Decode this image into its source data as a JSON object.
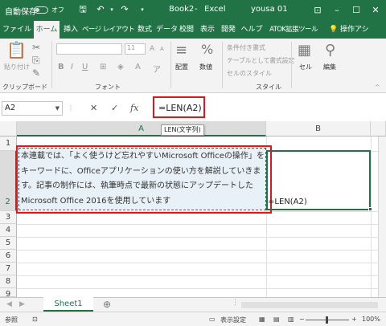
{
  "title_bar": {
    "autosave_label": "自動保存",
    "toggle_state": "オフ",
    "document": "Book2",
    "separator": "-",
    "app": "Excel",
    "user": "yousa 01"
  },
  "ribbon_tabs": [
    "ファイル",
    "ホーム",
    "挿入",
    "ページ レイアウト",
    "数式",
    "データ",
    "校閲",
    "表示",
    "開発",
    "ヘルプ",
    "ATOK拡張ツール",
    "操作アシ"
  ],
  "active_tab": "ホーム",
  "ribbon": {
    "clipboard": {
      "paste_label": "貼り付け",
      "group_label": "クリップボード"
    },
    "font": {
      "font_size": "11",
      "group_label": "フォント"
    },
    "alignment": {
      "label": "配置"
    },
    "number": {
      "label": "数値"
    },
    "styles": {
      "conditional": "条件付き書式",
      "table": "テーブルとして書式設定",
      "cell_styles": "セルのスタイル",
      "group_label": "スタイル"
    },
    "cells": {
      "label": "セル"
    },
    "editing": {
      "label": "編集"
    }
  },
  "formula_bar": {
    "name_box": "A2",
    "cancel_icon": "✕",
    "enter_icon": "✓",
    "fx_label": "fx",
    "formula": "=LEN(A2)"
  },
  "tooltip": "LEN(文字列)",
  "columns": [
    "A",
    "B"
  ],
  "rows": [
    "1",
    "2",
    "3",
    "4",
    "5",
    "6",
    "7",
    "8",
    "9"
  ],
  "cells": {
    "A2": "本連載では、「よく使うけど忘れやすいMicrosoft Officeの操作」をキーワードに、Officeアプリケーションの使い方を解説していきます。記事の制作には、執筆時点で最新の状態にアップデートしたMicrosoft Office 2016を使用しています",
    "B2": "=LEN(A2)"
  },
  "sheet_tab": "Sheet1",
  "status_bar": {
    "mode": "参照",
    "display_settings": "表示設定",
    "zoom": "100%"
  },
  "colors": {
    "accent": "#217346",
    "highlight": "#e8121c"
  }
}
